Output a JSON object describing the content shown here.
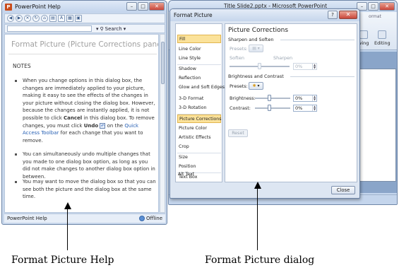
{
  "help_window": {
    "app_icon_letter": "P",
    "title": "PowerPoint Help",
    "controls": {
      "minimize": "–",
      "maximize": "□",
      "close": "✕"
    },
    "search_label": "Search",
    "heading": "Format Picture (Picture Corrections pane)",
    "notes_label": "NOTES",
    "note1": {
      "text_a": "When you change options in this dialog box, the changes are immediately applied to your picture, making it easy to see the effects of the changes in your picture without closing the dialog box. However, because the changes are instantly applied, it is not possible to click ",
      "cancel": "Cancel",
      "text_b": " in this dialog box. To remove changes, you must click ",
      "undo": "Undo",
      "text_c": " on the ",
      "qat_link": "Quick Access Toolbar",
      "text_d": " for each change that you want to remove."
    },
    "note2": "You can simultaneously undo multiple changes that you made to one dialog box option, as long as you did not make changes to another dialog box option in between.",
    "note3": "You may want to move the dialog box so that you can see both the picture and the dialog box at the same time.",
    "status_left": "PowerPoint Help",
    "status_right": "Offline"
  },
  "ppt_window": {
    "title": "Title Slide2.pptx - Microsoft PowerPoint",
    "ribbon_tab_fragment": "ormat",
    "ribbon_buttons": [
      "wing",
      "Editing"
    ]
  },
  "dialog": {
    "title": "Format Picture",
    "help_button": "?",
    "close_x": "✕",
    "nav_items": [
      "Fill",
      "Line Color",
      "Line Style",
      "Shadow",
      "Reflection",
      "Glow and Soft Edges",
      "3-D Format",
      "3-D Rotation",
      "Picture Corrections",
      "Picture Color",
      "Artistic Effects",
      "Crop",
      "Size",
      "Position",
      "Text Box",
      "Alt Text"
    ],
    "active_nav": "Picture Corrections",
    "panel_title": "Picture Corrections",
    "sharpen_section": "Sharpen and Soften",
    "presets_label": "Presets:",
    "soften_label": "Soften",
    "sharpen_label": "Sharpen",
    "sharpen_value": "0%",
    "brightness_section": "Brightness and Contrast",
    "presets2_label": "Presets:",
    "brightness_label": "Brightness:",
    "brightness_value": "0%",
    "contrast_label": "Contrast:",
    "contrast_value": "0%",
    "reset_label": "Reset",
    "close_label": "Close"
  },
  "captions": {
    "left": "Format Picture Help",
    "right": "Format Picture dialog"
  }
}
